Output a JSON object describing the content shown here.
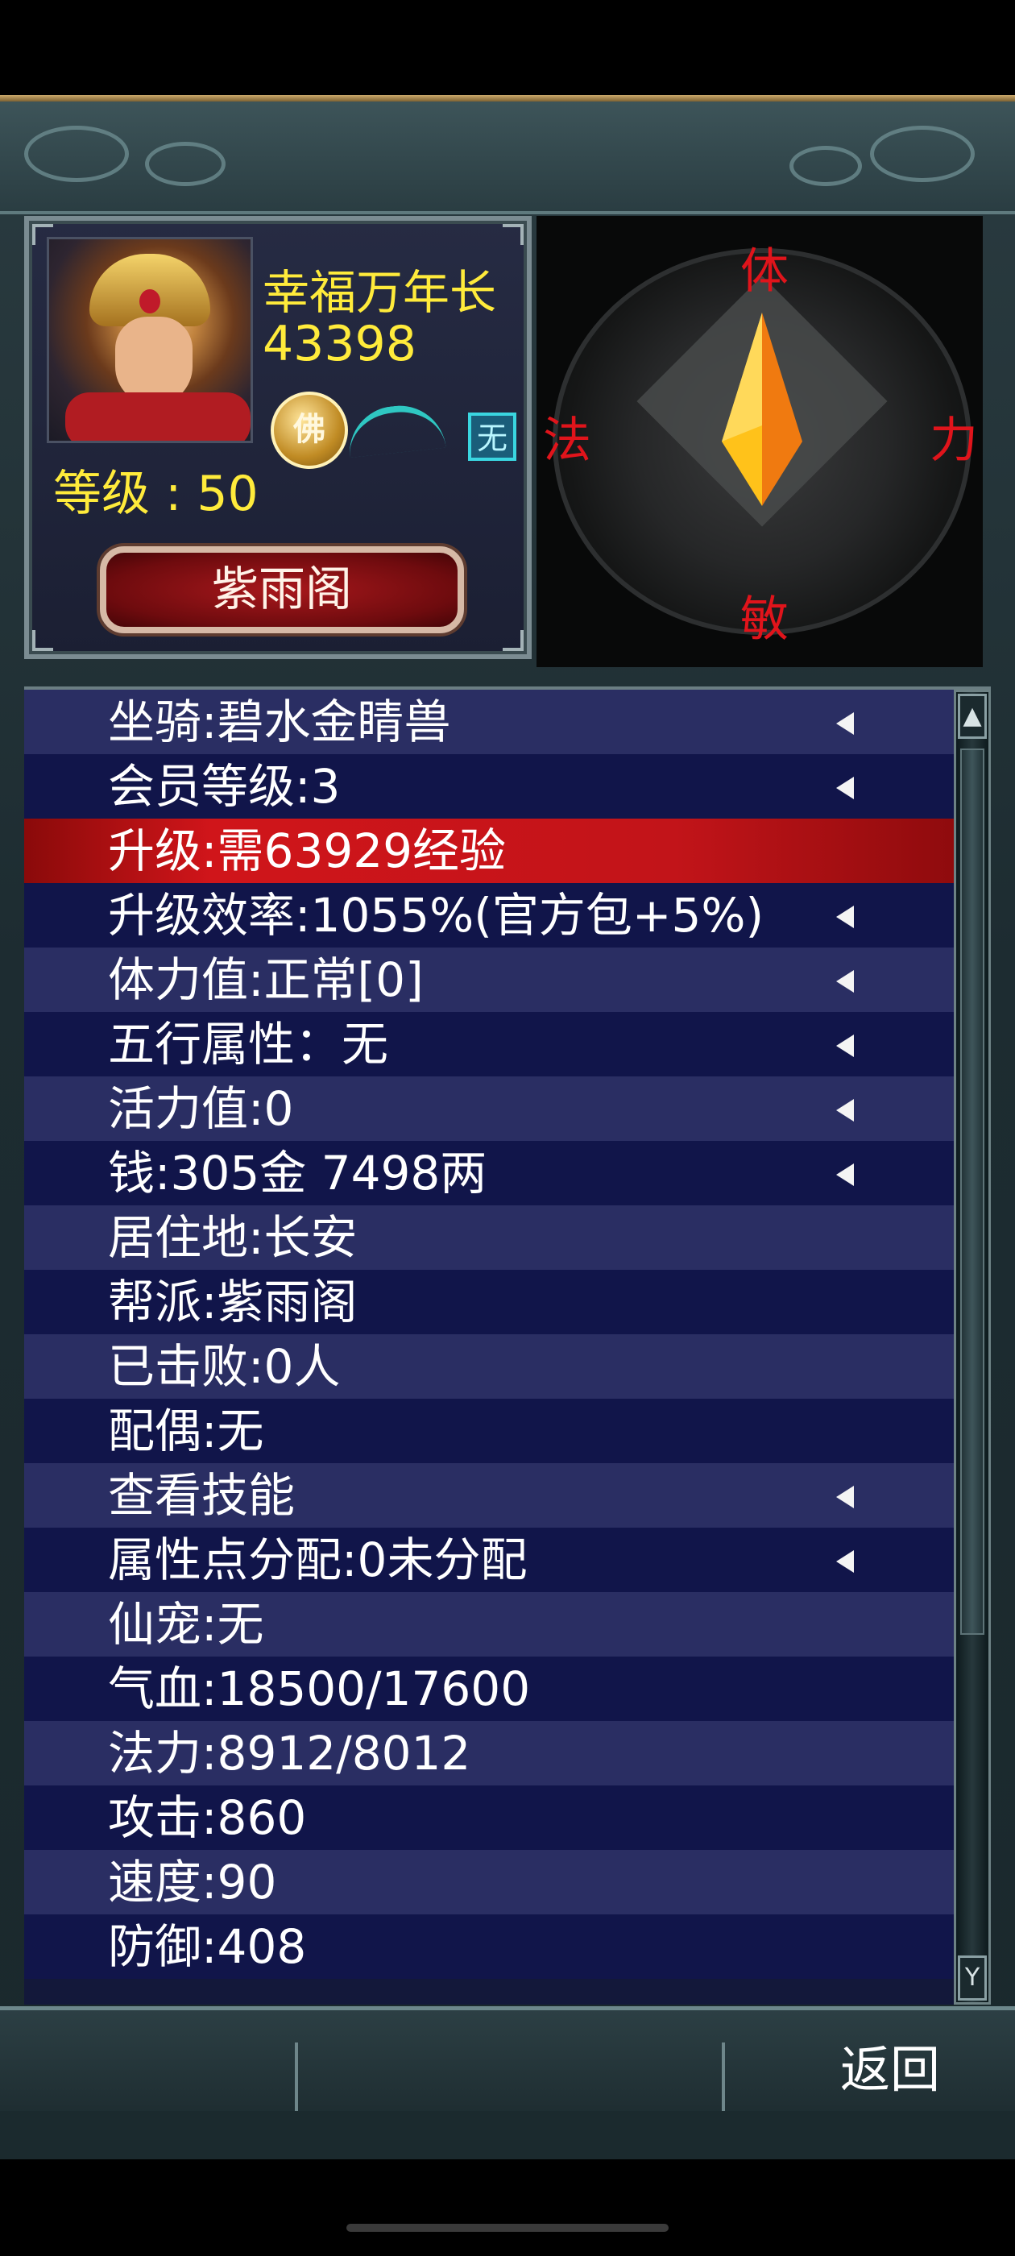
{
  "character": {
    "name": "幸福万年长",
    "id": "43398",
    "buddha_badge": "佛",
    "element_badge": "无",
    "level_text": "等级 : 50",
    "guild_button": "紫雨阁"
  },
  "compass": {
    "top": "体",
    "left": "法",
    "right": "力",
    "bottom": "敏"
  },
  "stats": [
    {
      "text": "坐骑:碧水金睛兽",
      "arrow": true
    },
    {
      "text": "会员等级:3",
      "arrow": true
    },
    {
      "text": "升级:需63929经验",
      "arrow": false,
      "highlight": true
    },
    {
      "text": "升级效率:1055%(官方包+5%)",
      "arrow": true
    },
    {
      "text": "体力值:正常[0]",
      "arrow": true
    },
    {
      "text": "五行属性：无",
      "arrow": true
    },
    {
      "text": "活力值:0",
      "arrow": true
    },
    {
      "text": "钱:305金 7498两",
      "arrow": true
    },
    {
      "text": "居住地:长安",
      "arrow": false
    },
    {
      "text": "帮派:紫雨阁",
      "arrow": false
    },
    {
      "text": "已击败:0人",
      "arrow": false
    },
    {
      "text": "配偶:无",
      "arrow": false
    },
    {
      "text": "查看技能",
      "arrow": true
    },
    {
      "text": "属性点分配:0未分配",
      "arrow": true
    },
    {
      "text": "仙宠:无",
      "arrow": false
    },
    {
      "text": "气血:18500/17600",
      "arrow": false
    },
    {
      "text": "法力:8912/8012",
      "arrow": false
    },
    {
      "text": "攻击:860",
      "arrow": false
    },
    {
      "text": "速度:90",
      "arrow": false
    },
    {
      "text": "防御:408",
      "arrow": false
    }
  ],
  "scrollbar": {
    "up": "▲",
    "down": "Y"
  },
  "footer": {
    "back_button": "返回"
  }
}
